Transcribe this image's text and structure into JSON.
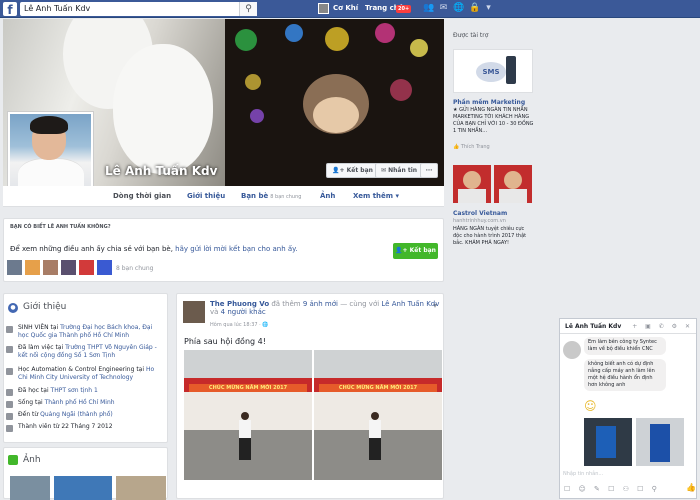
{
  "topbar": {
    "logo": "f",
    "search_value": "Lê Anh Tuấn Kdv",
    "search_icon": "search-icon",
    "user_name": "Cơ Khí",
    "home_label": "Trang chủ",
    "home_badge": "20+"
  },
  "profile": {
    "name": "Lê Anh Tuấn Kdv",
    "friend_button": "Kết bạn",
    "message_button": "Nhắn tin",
    "more_button": "···"
  },
  "nav": {
    "timeline": "Dòng thời gian",
    "about": "Giới thiệu",
    "friends": "Bạn bè",
    "friends_sub": "8 bạn chung",
    "photos": "Ảnh",
    "more": "Xem thêm"
  },
  "suggest": {
    "heading": "BẠN CÓ BIẾT LÊ ANH TUẤN KHÔNG?",
    "text_prefix": "Để xem những điều anh ấy chia sẻ với bạn bè, ",
    "text_link": "hãy gửi lời mời kết bạn cho anh ấy.",
    "add_button": "Kết bạn",
    "mutual": "8 bạn chung"
  },
  "intro": {
    "title": "Giới thiệu",
    "items": [
      {
        "pre": "SINH VIÊN tại ",
        "link": "Trường Đại học Bách khoa, Đại học Quốc gia Thành phố Hồ Chí Minh"
      },
      {
        "pre": "Đã làm việc tại ",
        "link": "Trường THPT Võ Nguyên Giáp - kết nối cộng đồng Số 1 Sơn Tịnh"
      },
      {
        "pre": "Học Automation & Control Engineering tại ",
        "link": "Ho Chi Minh City University of Technology"
      },
      {
        "pre": "Đã học tại ",
        "link": "THPT sơn tịnh 1"
      },
      {
        "pre": "Sống tại ",
        "link": "Thành phố Hồ Chí Minh"
      },
      {
        "pre": "Đến từ ",
        "link": "Quảng Ngãi (thành phố)"
      },
      {
        "pre": "Thành viên từ 22 Tháng 7 2012",
        "link": ""
      }
    ]
  },
  "photos_section": {
    "title": "Ảnh"
  },
  "post": {
    "author": "The Phuong Vo",
    "action": " đã thêm ",
    "action_link": "9 ảnh mới",
    "with": " — cùng với ",
    "tag": "Lê Anh Tuấn Kdv",
    "and": " và ",
    "others": "4 người khác",
    "time": "Hôm qua lúc 18:37 · ",
    "text": "Phía sau hội đồng 4!",
    "banner_text": "CHÚC MỪNG NĂM MỚI 2017"
  },
  "sidebar": {
    "sponsored": "Được tài trợ",
    "ad1_title": "Phần mềm Marketing",
    "ad1_text": "★ GỬI HÀNG NGÀN TIN NHẮN MARKETING TỚI KHÁCH HÀNG CỦA BẠN CHỈ VỚI 10 - 30 ĐỒNG 1 TIN NHẮN...",
    "ad1_link": "Thích Trang",
    "ad1_img_text": "SMS",
    "ad2_title": "Castrol Vietnam",
    "ad2_domain": "hanhtrinhhuy.com.vn",
    "ad2_text": "HÀNG NGÀN tuyệt chiêu cực độc cho hành trình 2017 thật bắc. KHÁM PHÁ NGAY!"
  },
  "chat": {
    "title": "Lê Anh Tuấn Kdv",
    "icons": "+ ▣ ✆ ⚙ ✕",
    "messages": [
      "Em làm bên công ty Syntec làm về bộ điều khiển CNC",
      "không biết anh có dự định nắng cấp máy anh làm lên một hệ điều hành ổn định hơn không anh"
    ],
    "emoji": "☺",
    "input_placeholder": "Nhập tin nhắn...",
    "tools": "☐ ☺ ✎ ☐ ⚇ ☐ ⚲",
    "like": "👍"
  },
  "colors": {
    "brand": "#3b5998",
    "link": "#365899",
    "green": "#42b72a"
  }
}
